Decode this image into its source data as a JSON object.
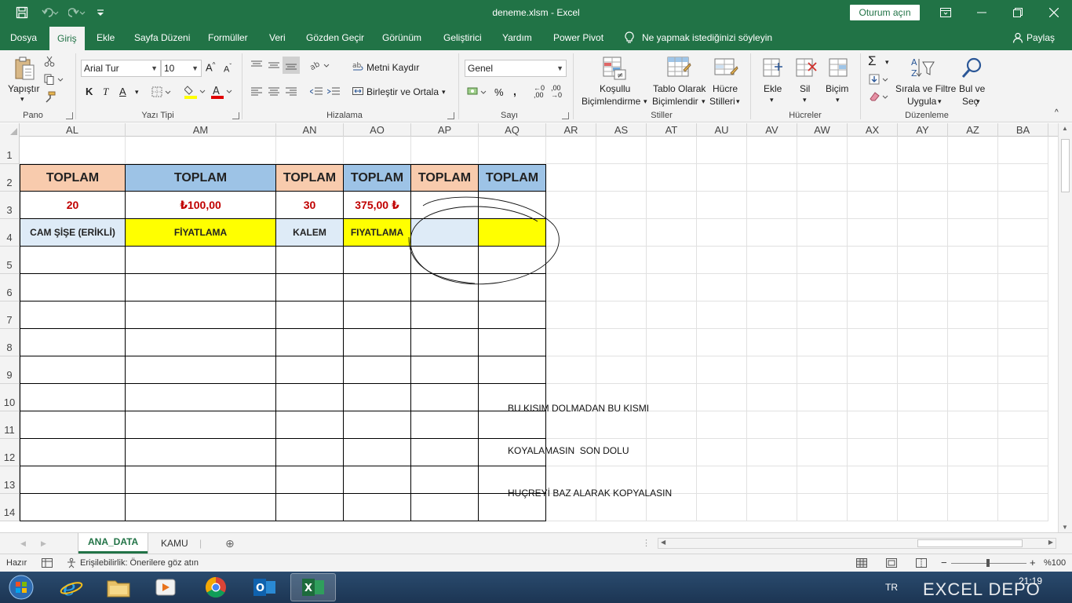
{
  "titlebar": {
    "title": "deneme.xlsm  -  Excel",
    "signin_label": "Oturum açın"
  },
  "menu": {
    "tabs": [
      "Dosya",
      "Giriş",
      "Ekle",
      "Sayfa Düzeni",
      "Formüller",
      "Veri",
      "Gözden Geçir",
      "Görünüm",
      "Geliştirici",
      "Yardım",
      "Power Pivot"
    ],
    "active_tab": "Giriş",
    "tell_me": "Ne yapmak istediğinizi söyleyin",
    "share": "Paylaş"
  },
  "ribbon": {
    "paste_label": "Yapıştır",
    "font_name": "Arial Tur",
    "font_size": "10",
    "wrap_text": "Metni Kaydır",
    "merge_center": "Birleştir ve Ortala",
    "number_format": "Genel",
    "cond_format_1": "Koşullu",
    "cond_format_2": "Biçimlendirme",
    "format_table_1": "Tablo Olarak",
    "format_table_2": "Biçimlendir",
    "cell_styles_1": "Hücre",
    "cell_styles_2": "Stilleri",
    "insert": "Ekle",
    "delete": "Sil",
    "format": "Biçim",
    "sort_filter_1": "Sırala ve Filtre",
    "sort_filter_2": "Uygula",
    "find_select_1": "Bul ve",
    "find_select_2": "Seç",
    "groups": {
      "clipboard": "Pano",
      "font": "Yazı Tipi",
      "alignment": "Hizalama",
      "number": "Sayı",
      "styles": "Stiller",
      "cells": "Hücreler",
      "editing": "Düzenleme"
    }
  },
  "sheet": {
    "columns": [
      "AL",
      "AM",
      "AN",
      "AO",
      "AP",
      "AQ",
      "AR",
      "AS",
      "AT",
      "AU",
      "AV",
      "AW",
      "AX",
      "AY",
      "AZ",
      "BA"
    ],
    "rows": [
      "1",
      "2",
      "3",
      "4",
      "5",
      "6",
      "7",
      "8",
      "9",
      "10",
      "11",
      "12",
      "13",
      "14"
    ],
    "row2": [
      "TOPLAM",
      "TOPLAM",
      "TOPLAM",
      "TOPLAM",
      "TOPLAM",
      "TOPLAM"
    ],
    "row3": [
      "20",
      "₺100,00",
      "30",
      "375,00 ₺",
      "",
      ""
    ],
    "row4": [
      "CAM ŞİŞE (ERİKLİ)",
      "FİYATLAMA",
      "KALEM",
      "FIYATLAMA",
      "",
      ""
    ],
    "note_lines": [
      "BU KISIM DOLMADAN BU KISMI",
      "KOYALAMASIN  SON DOLU",
      "HUÇREYİ BAZ ALARAK KOPYALASIN"
    ],
    "colors": {
      "salmon": "#f8cbad",
      "blue": "#9dc3e6",
      "light_blue": "#deebf7",
      "yellow": "#ffff00",
      "red_text": "#c00000"
    }
  },
  "sheet_tabs": [
    "ANA_DATA",
    "KAMU"
  ],
  "active_sheet": "ANA_DATA",
  "status": {
    "ready": "Hazır",
    "accessibility": "Erişilebilirlik: Önerilere göz atın",
    "zoom": "%100"
  },
  "taskbar": {
    "lang": "TR",
    "time": "21:19",
    "watermark": "EXCEL DEPO"
  }
}
